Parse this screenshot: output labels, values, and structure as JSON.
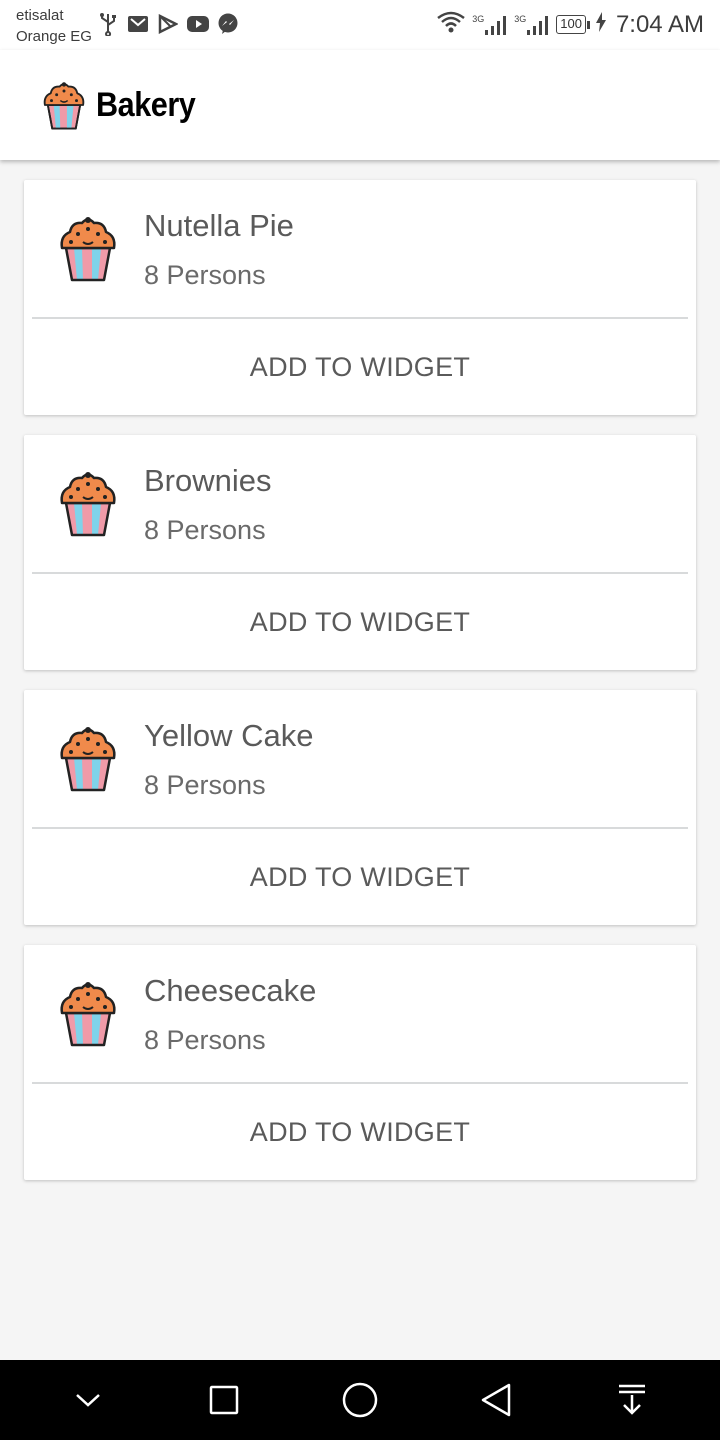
{
  "status_bar": {
    "carrier_line1": "etisalat",
    "carrier_line2": "Orange EG",
    "network_1": "3G",
    "network_2": "3G",
    "battery": "100",
    "time": "7:04 AM",
    "notification_icons": [
      "usb-icon",
      "gmail-icon",
      "play-store-icon",
      "youtube-icon",
      "messenger-icon"
    ]
  },
  "app_bar": {
    "title": "Bakery"
  },
  "recipes": [
    {
      "name": "Nutella Pie",
      "servings": "8 Persons",
      "action": "ADD TO WIDGET"
    },
    {
      "name": "Brownies",
      "servings": "8 Persons",
      "action": "ADD TO WIDGET"
    },
    {
      "name": "Yellow Cake",
      "servings": "8 Persons",
      "action": "ADD TO WIDGET"
    },
    {
      "name": "Cheesecake",
      "servings": "8 Persons",
      "action": "ADD TO WIDGET"
    }
  ],
  "colors": {
    "cupcake_top": "#f08a4b",
    "cupcake_stripe_blue": "#7fd3ea",
    "cupcake_stripe_pink": "#f09aa8",
    "background": "#f5f5f5",
    "nav_bar": "#000000"
  }
}
